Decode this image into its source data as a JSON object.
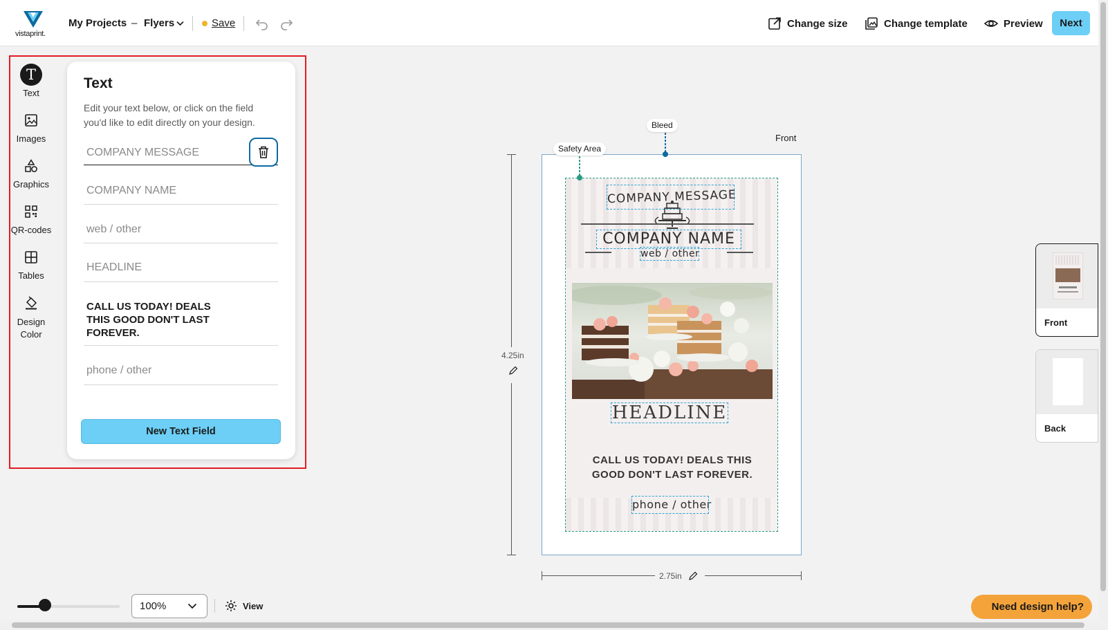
{
  "header": {
    "logo_text": "vistaprint.",
    "my_projects": "My Projects",
    "separator": "–",
    "product": "Flyers",
    "save_label": "Save",
    "change_size": "Change size",
    "change_template": "Change template",
    "preview": "Preview",
    "next": "Next"
  },
  "sidebar": {
    "items": [
      {
        "label": "Text",
        "icon": "text-icon"
      },
      {
        "label": "Images",
        "icon": "image-icon"
      },
      {
        "label": "Graphics",
        "icon": "shapes-icon"
      },
      {
        "label": "QR-codes",
        "icon": "qr-code-icon"
      },
      {
        "label": "Tables",
        "icon": "table-icon"
      },
      {
        "label": "Design Color",
        "icon": "paint-bucket-icon"
      }
    ]
  },
  "text_panel": {
    "title": "Text",
    "description": "Edit your text below, or click on the field you'd like to edit directly on your design.",
    "fields": [
      {
        "placeholder": "COMPANY MESSAGE"
      },
      {
        "placeholder": "COMPANY NAME"
      },
      {
        "placeholder": "web / other"
      },
      {
        "placeholder": "HEADLINE"
      },
      {
        "value": "CALL US TODAY! DEALS THIS GOOD DON'T LAST FOREVER."
      },
      {
        "placeholder": "phone / other"
      }
    ],
    "new_field_button": "New Text Field"
  },
  "canvas": {
    "safety_area_label": "Safety Area",
    "bleed_label": "Bleed",
    "side_label": "Front",
    "height_label": "4.25in",
    "width_label": "2.75in",
    "flyer": {
      "company_message": "COMPANY MESSAGE",
      "company_name": "COMPANY NAME",
      "web": "web / other",
      "headline": "HEADLINE",
      "body": "CALL US TODAY! DEALS THIS GOOD DON'T LAST FOREVER.",
      "phone": "phone / other"
    }
  },
  "pages": [
    {
      "label": "Front",
      "active": true
    },
    {
      "label": "Back",
      "active": false
    }
  ],
  "footer": {
    "zoom_value": "100%",
    "zoom_slider_fraction": 0.27,
    "view_label": "View",
    "help_button": "Need design help?"
  },
  "colors": {
    "accent": "#6dcff6",
    "highlight": "#e31b23",
    "help": "#f4a33a",
    "safety_line": "#2b9a85",
    "bleed_line": "#0d6aa0"
  }
}
